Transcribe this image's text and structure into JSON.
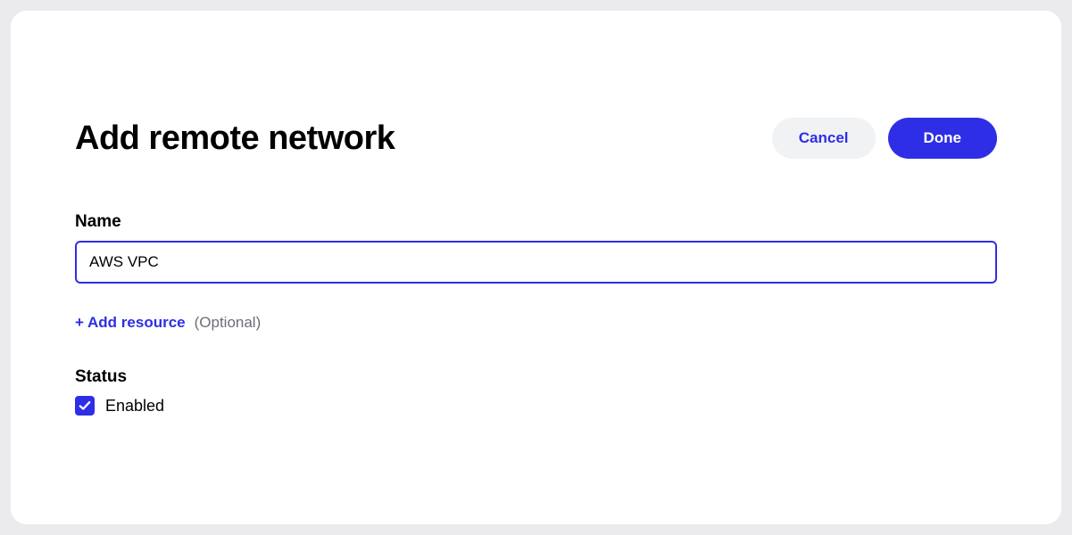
{
  "header": {
    "title": "Add remote network",
    "cancel_label": "Cancel",
    "done_label": "Done"
  },
  "form": {
    "name_label": "Name",
    "name_value": "AWS VPC",
    "add_resource_label": "+ Add resource",
    "add_resource_optional": "(Optional)",
    "status_label": "Status",
    "status_checkbox_label": "Enabled",
    "status_checked": true
  },
  "colors": {
    "primary": "#2e2ee6",
    "secondary_bg": "#f1f2f4",
    "muted": "#6b6f76"
  }
}
